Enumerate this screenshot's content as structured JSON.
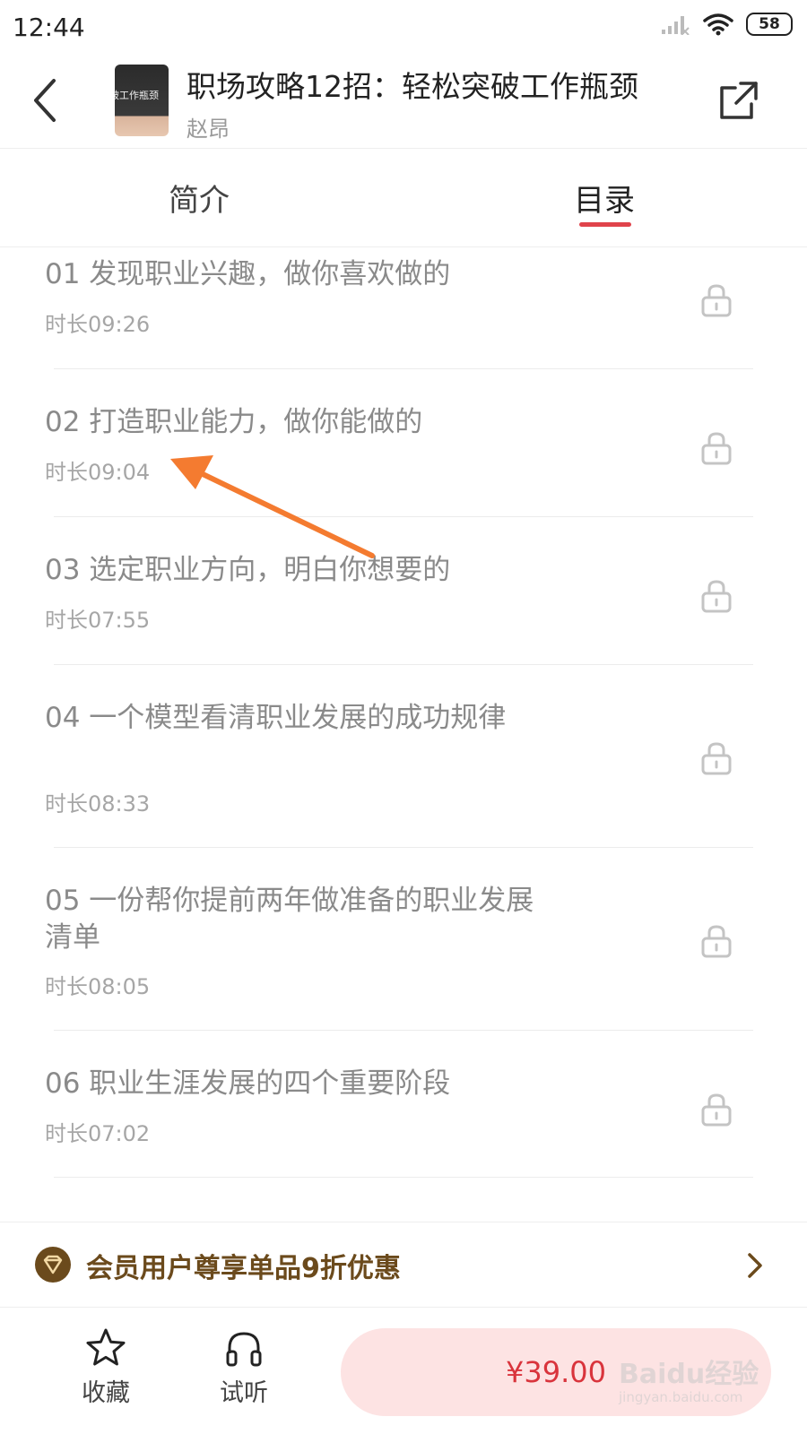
{
  "status_bar": {
    "time": "12:44",
    "battery": "58",
    "icons": [
      "signal-icon",
      "wifi-icon",
      "battery-icon"
    ]
  },
  "header": {
    "title": "职场攻略12招：轻松突破工作瓶颈",
    "author": "赵昂",
    "cover_text": "破工作瓶颈"
  },
  "tabs": [
    {
      "label": "简介",
      "active": false
    },
    {
      "label": "目录",
      "active": true
    }
  ],
  "chapters": [
    {
      "title": "01 发现职业兴趣，做你喜欢做的",
      "duration": "时长09:26",
      "locked": true
    },
    {
      "title": "02 打造职业能力，做你能做的",
      "duration": "时长09:04",
      "locked": true
    },
    {
      "title": "03 选定职业方向，明白你想要的",
      "duration": "时长07:55",
      "locked": true
    },
    {
      "title": "04 一个模型看清职业发展的成功规律",
      "duration": "时长08:33",
      "locked": true
    },
    {
      "title": "05 一份帮你提前两年做准备的职业发展清单",
      "duration": "时长08:05",
      "locked": true
    },
    {
      "title": "06 职业生涯发展的四个重要阶段",
      "duration": "时长07:02",
      "locked": true
    }
  ],
  "member_banner": {
    "text": "会员用户尊享单品9折优惠"
  },
  "bottom_bar": {
    "favorite_label": "收藏",
    "listen_label": "试听",
    "price": "¥39.00"
  },
  "watermark": {
    "brand": "Baidu经验",
    "url": "jingyan.baidu.com"
  },
  "colors": {
    "accent": "#e0434b",
    "price": "#d9343c",
    "buy_bg": "#fde3e3",
    "member_gold": "#6b4a1c",
    "annotation_arrow": "#f47b30"
  }
}
